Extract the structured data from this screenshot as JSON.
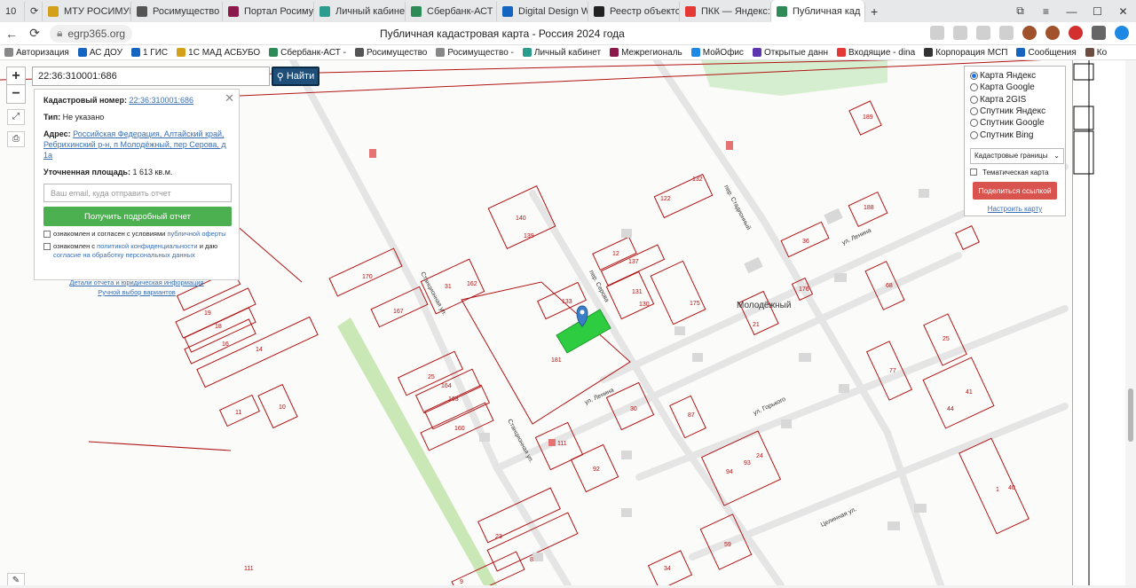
{
  "browser": {
    "tab_counter": "10",
    "tabs": [
      {
        "label": "МТУ РОСИМУЩЕ",
        "color": "#d4a017"
      },
      {
        "label": "Росимущество",
        "color": "#555"
      },
      {
        "label": "Портал Росиму",
        "color": "#8b1a4a"
      },
      {
        "label": "Личный кабинет",
        "color": "#2a9d8f"
      },
      {
        "label": "Сбербанк-АСТ -",
        "color": "#2e8b57"
      },
      {
        "label": "Digital Design We",
        "color": "#1565c0"
      },
      {
        "label": "Реестр объектов",
        "color": "#222"
      },
      {
        "label": "ПКК — Яндекс: на",
        "color": "#e53935"
      },
      {
        "label": "Публичная кад",
        "color": "#2e8b57"
      }
    ],
    "url": "egrp365.org",
    "page_title": "Публичная кадастровая карта - Россия 2024 года",
    "bookmarks": [
      {
        "label": "Авторизация",
        "color": "#888"
      },
      {
        "label": "АС ДОУ",
        "color": "#1565c0"
      },
      {
        "label": "1 ГИС",
        "color": "#1565c0"
      },
      {
        "label": "1С МАД АСБУБО",
        "color": "#d4a017"
      },
      {
        "label": "Сбербанк-АСТ -",
        "color": "#2e8b57"
      },
      {
        "label": "Росимущество",
        "color": "#555"
      },
      {
        "label": "Росимущество -",
        "color": "#888"
      },
      {
        "label": "Личный кабинет",
        "color": "#2a9d8f"
      },
      {
        "label": "Межрегиональ",
        "color": "#8b1a4a"
      },
      {
        "label": "МойОфис",
        "color": "#1e88e5"
      },
      {
        "label": "Открытые данн",
        "color": "#5e35b1"
      },
      {
        "label": "Входящие - dinа",
        "color": "#e53935"
      },
      {
        "label": "Корпорация МСП",
        "color": "#333"
      },
      {
        "label": "Сообщения",
        "color": "#1565c0"
      },
      {
        "label": "Ко",
        "color": "#6d4c41"
      }
    ]
  },
  "search": {
    "value": "22:36:310001:686",
    "button": "Найти"
  },
  "info": {
    "cadastral_label": "Кадастровый номер:",
    "cadastral_value": "22:36:310001:686",
    "type_label": "Тип:",
    "type_value": "Не указано",
    "address_label": "Адрес:",
    "address_value": "Российская Федерация, Алтайский край, Ребрихинский р-н, п Молодёжный, пер Серова, д 1а",
    "area_label": "Уточненная площадь:",
    "area_value": "1 613 кв.м.",
    "email_placeholder": "Ваш email, куда отправить отчет",
    "get_report": "Получить подробный отчет",
    "agree1_text": "ознакомлен и согласен с условиями",
    "agree1_link": "публичной оферты",
    "agree2_text": "ознакомлен с",
    "agree2_link": "политикой конфиденциальности",
    "agree2_tail": "и даю",
    "agree2_link2": "согласие на обработку персональных данных",
    "details_link": "Детали отчета и юридическая информация",
    "manual_link": "Ручной выбор вариантов"
  },
  "layers": {
    "options": [
      "Карта Яндекс",
      "Карта Google",
      "Карта 2GIS",
      "Спутник Яндекс",
      "Спутник Google",
      "Спутник Bing"
    ],
    "selected_index": 0,
    "select_value": "Кадастровые границы",
    "thematic": "Тематическая карта",
    "share": "Поделиться ссылкой",
    "customize": "Настроить карту"
  },
  "map_labels": {
    "place": "Молодёжный",
    "streets": [
      "Станционная ул.",
      "пер. Серова",
      "ул. Ленина",
      "пер. Стадионный",
      "ул. Ленина",
      "ул. Горького",
      "Целинная ул."
    ],
    "parcels": [
      "140",
      "139",
      "170",
      "167",
      "31",
      "162",
      "12",
      "137",
      "131",
      "130",
      "175",
      "133",
      "181",
      "25",
      "164",
      "163",
      "160",
      "30",
      "111",
      "92",
      "87",
      "94",
      "93",
      "24",
      "122",
      "132",
      "36",
      "188",
      "176",
      "68",
      "25",
      "77",
      "41",
      "44",
      "40",
      "1",
      "59",
      "34",
      "23",
      "8",
      "9",
      "19",
      "18",
      "16",
      "14",
      "11",
      "10",
      "111",
      "189",
      "21"
    ]
  },
  "colors": {
    "boundary": "#b01414",
    "selected_parcel": "#2ecc40",
    "search_btn": "#1f4e79",
    "report_btn": "#4caf50",
    "share_btn": "#d9534f"
  }
}
